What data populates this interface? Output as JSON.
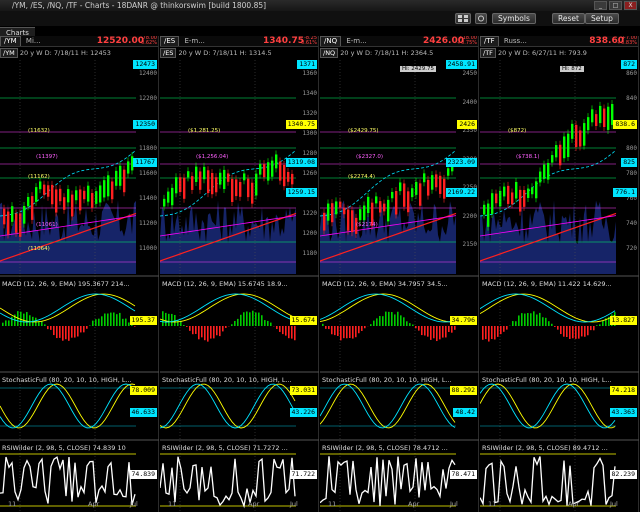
{
  "window": {
    "title": "/YM, /ES, /NQ, /TF - Charts - 18DANR @ thinkorswim [build 1800.85]",
    "btn_min": "_",
    "btn_max": "□",
    "btn_close": "X"
  },
  "toolbar": {
    "buttons": [
      "Symbols",
      "Reset",
      "Setup"
    ]
  },
  "tab_label": "Charts",
  "colors": {
    "bg": "#000000",
    "up": "#00ff00",
    "down": "#ff2020",
    "macd": "#ffff00",
    "cyan": "#00e5ff",
    "fib": "#ff00ff"
  },
  "panels": [
    {
      "symbol": "/YM",
      "desc": "Mi...",
      "price": "12520.00",
      "chg1": "-78.00",
      "chg2": "-0.62%",
      "tf": "20 y W",
      "info": "D: 7/18/11",
      "ohlc": "H: 12453",
      "tags": [
        {
          "text": "12473",
          "bg": "#00e5ff"
        },
        {
          "text": "12350",
          "bg": "#00e5ff"
        },
        {
          "text": "11767",
          "bg": "#00e5ff"
        }
      ],
      "axis": [
        "12400",
        "12200",
        "12000",
        "11800",
        "11600",
        "11400",
        "11200",
        "11000"
      ],
      "fib": [
        "(11632)",
        "(11397)",
        "(11162)",
        "(11061)",
        "(11064)"
      ],
      "macd": {
        "label": "MACD (12, 26, 9, EMA) 195.3677 214...",
        "tag": "195.37"
      },
      "stoch": {
        "label": "StochasticFull (80, 20, 10, 10, HIGH, L...",
        "tag1": "78.009",
        "tag2": "46.633"
      },
      "rsi": {
        "label": "RSIWilder (2, 98, 5, CLOSE) 74.839 10",
        "tag": "74.839"
      },
      "xlabels": [
        "11",
        "Apr",
        "Jul"
      ]
    },
    {
      "symbol": "/ES",
      "desc": "E-m...",
      "price": "1340.75",
      "chg1": "-8.25",
      "chg2": "-0.61%",
      "tf": "20 y W",
      "info": "D: 7/18/11",
      "ohlc": "H: 1314.5",
      "tags": [
        {
          "text": "1371",
          "bg": "#00e5ff"
        },
        {
          "text": "1340.75",
          "bg": "#ffff00"
        },
        {
          "text": "1319.08",
          "bg": "#00e5ff"
        },
        {
          "text": "1259.15",
          "bg": "#00e5ff"
        }
      ],
      "axis": [
        "1360",
        "1340",
        "1320",
        "1300",
        "1280",
        "1260",
        "1240",
        "1220",
        "1200",
        "1180"
      ],
      "fib": [
        "($1,281.25)",
        "($1,256.04)"
      ],
      "macd": {
        "label": "MACD (12, 26, 9, EMA) 15.6745 18.9...",
        "tag": "15.674"
      },
      "stoch": {
        "label": "StochasticFull (80, 20, 10, 10, HIGH, L...",
        "tag1": "73.031",
        "tag2": "43.226"
      },
      "rsi": {
        "label": "RSIWilder (2, 98, 5, CLOSE) 71.7272 ...",
        "tag": "71.722"
      },
      "xlabels": [
        "11",
        "Apr",
        "Jul"
      ]
    },
    {
      "symbol": "/NQ",
      "desc": "E-m...",
      "price": "2426.00",
      "chg1": "+18.00",
      "chg2": "+0.75%",
      "tf": "20 y W",
      "info": "D: 7/18/11",
      "ohlc": "H: 2364.5",
      "tags": [
        {
          "text": "2458.91",
          "bg": "#00e5ff"
        },
        {
          "text": "2426",
          "bg": "#ffff00"
        },
        {
          "text": "2323.09",
          "bg": "#00e5ff"
        },
        {
          "text": "2169.22",
          "bg": "#00e5ff"
        }
      ],
      "axis": [
        "2450",
        "2400",
        "2350",
        "2300",
        "2250",
        "2200",
        "2150"
      ],
      "fib": [
        "($2429.75)",
        "($2327.0)",
        "($2274.4)",
        "($2174)"
      ],
      "hi": "Hi: 2429.75",
      "macd": {
        "label": "MACD (12, 26, 9, EMA) 34.7957 34.5...",
        "tag": "34.796"
      },
      "stoch": {
        "label": "StochasticFull (80, 20, 10, 10, HIGH, L...",
        "tag1": "88.292",
        "tag2": "48.42"
      },
      "rsi": {
        "label": "RSIWilder (2, 98, 5, CLOSE) 78.4712 ...",
        "tag": "78.471"
      },
      "xlabels": [
        "11",
        "Apr",
        "Jul"
      ]
    },
    {
      "symbol": "/TF",
      "desc": "Russ...",
      "price": "838.60",
      "chg1": "+7.00",
      "chg2": "+0.83%",
      "tf": "20 y W",
      "info": "D: 6/27/11",
      "ohlc": "H: 793.9",
      "tags": [
        {
          "text": "872",
          "bg": "#00e5ff"
        },
        {
          "text": "838.6",
          "bg": "#ffff00"
        },
        {
          "text": "825",
          "bg": "#00e5ff"
        },
        {
          "text": "776.1",
          "bg": "#00e5ff"
        }
      ],
      "axis": [
        "860",
        "840",
        "820",
        "800",
        "780",
        "760",
        "740",
        "720"
      ],
      "fib": [
        "($872)",
        "($738.1)"
      ],
      "hi": "Hi: 872",
      "macd": {
        "label": "MACD (12, 26, 9, EMA) 11.422 14.629...",
        "tag": "13.827"
      },
      "stoch": {
        "label": "StochasticFull (80, 20, 10, 10, HIGH, L...",
        "tag1": "74.218",
        "tag2": "43.363"
      },
      "rsi": {
        "label": "RSIWilder (2, 98, 5, CLOSE) 89.4712 ...",
        "tag": "82.239"
      },
      "xlabels": [
        "11",
        "Apr",
        "Jul"
      ]
    }
  ]
}
